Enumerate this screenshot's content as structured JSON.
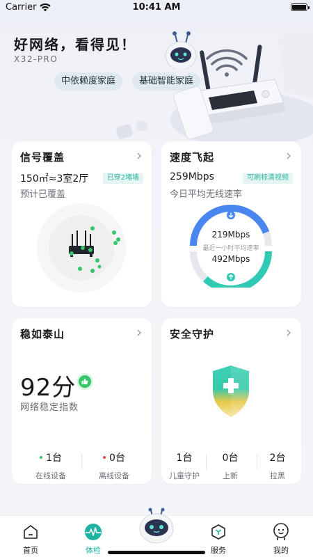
{
  "status_bar": {
    "carrier": "Carrier",
    "time": "10:41 AM"
  },
  "hero": {
    "title": "好网络，看得见！",
    "model": "X32-PRO",
    "tags": [
      "中依赖度家庭",
      "基础智能家庭"
    ]
  },
  "coverage": {
    "title": "信号覆盖",
    "area": "150㎡≈3室2厅",
    "badge": "已穿2堵墙",
    "note": "预计已覆盖"
  },
  "speed": {
    "title": "速度飞起",
    "value": "259Mbps",
    "badge": "可刷标清视频",
    "note": "今日平均无线速率",
    "download": "219Mbps",
    "gauge_caption": "最近一小时平均速率",
    "upload": "492Mbps"
  },
  "stability": {
    "title": "稳如泰山",
    "score": "92分",
    "label": "网络稳定指数",
    "online_value": "1台",
    "online_label": "在线设备",
    "offline_value": "0台",
    "offline_label": "离线设备"
  },
  "security": {
    "title": "安全守护",
    "stats": [
      {
        "value": "1台",
        "label": "儿童守护"
      },
      {
        "value": "0台",
        "label": "上新"
      },
      {
        "value": "2台",
        "label": "拉黑"
      }
    ]
  },
  "tabbar": {
    "items": [
      {
        "label": "首页"
      },
      {
        "label": "体检"
      },
      {
        "label": "服务"
      },
      {
        "label": "我的"
      }
    ]
  },
  "colors": {
    "accent": "#1fb3a2",
    "blue": "#4a86f0",
    "green": "#35c66a",
    "red": "#e64646"
  }
}
